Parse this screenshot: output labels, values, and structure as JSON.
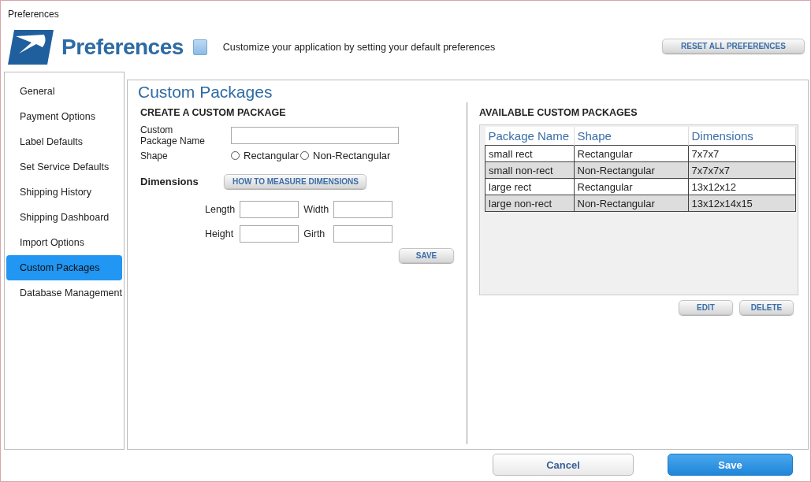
{
  "window": {
    "title": "Preferences"
  },
  "header": {
    "title": "Preferences",
    "subtitle": "Customize your application by setting your default preferences",
    "reset_button": "RESET ALL PREFERENCES"
  },
  "sidebar": {
    "items": [
      {
        "label": "General",
        "selected": false
      },
      {
        "label": "Payment Options",
        "selected": false
      },
      {
        "label": "Label Defaults",
        "selected": false
      },
      {
        "label": "Set Service Defaults",
        "selected": false
      },
      {
        "label": "Shipping History",
        "selected": false
      },
      {
        "label": "Shipping Dashboard",
        "selected": false
      },
      {
        "label": "Import Options",
        "selected": false
      },
      {
        "label": "Custom Packages",
        "selected": true
      },
      {
        "label": "Database Management",
        "selected": false
      }
    ]
  },
  "panel": {
    "title": "Custom Packages",
    "create": {
      "heading": "CREATE A CUSTOM PACKAGE",
      "name_label": "Custom Package Name",
      "shape_label": "Shape",
      "shapes": [
        {
          "label": "Rectangular",
          "selected": false
        },
        {
          "label": "Non-Rectangular",
          "selected": false
        }
      ],
      "dimensions_label": "Dimensions",
      "measure_button": "HOW TO MEASURE DIMENSIONS",
      "fields": [
        {
          "label": "Length"
        },
        {
          "label": "Width"
        },
        {
          "label": "Height"
        },
        {
          "label": "Girth"
        }
      ],
      "save_button": "SAVE"
    },
    "available": {
      "heading": "AVAILABLE CUSTOM PACKAGES",
      "table": {
        "columns": [
          "Package Name",
          "Shape",
          "Dimensions"
        ],
        "rows": [
          [
            "small rect",
            "Rectangular",
            "7x7x7"
          ],
          [
            "small non-rect",
            "Non-Rectangular",
            "7x7x7x7"
          ],
          [
            "large rect",
            "Rectangular",
            "13x12x12"
          ],
          [
            "large non-rect",
            "Non-Rectangular",
            "13x12x14x15"
          ]
        ]
      },
      "buttons": [
        "EDIT",
        "DELETE"
      ]
    }
  },
  "footer": {
    "buttons": [
      {
        "label": "Cancel",
        "kind": "secondary"
      },
      {
        "label": "Save",
        "kind": "primary"
      }
    ]
  }
}
